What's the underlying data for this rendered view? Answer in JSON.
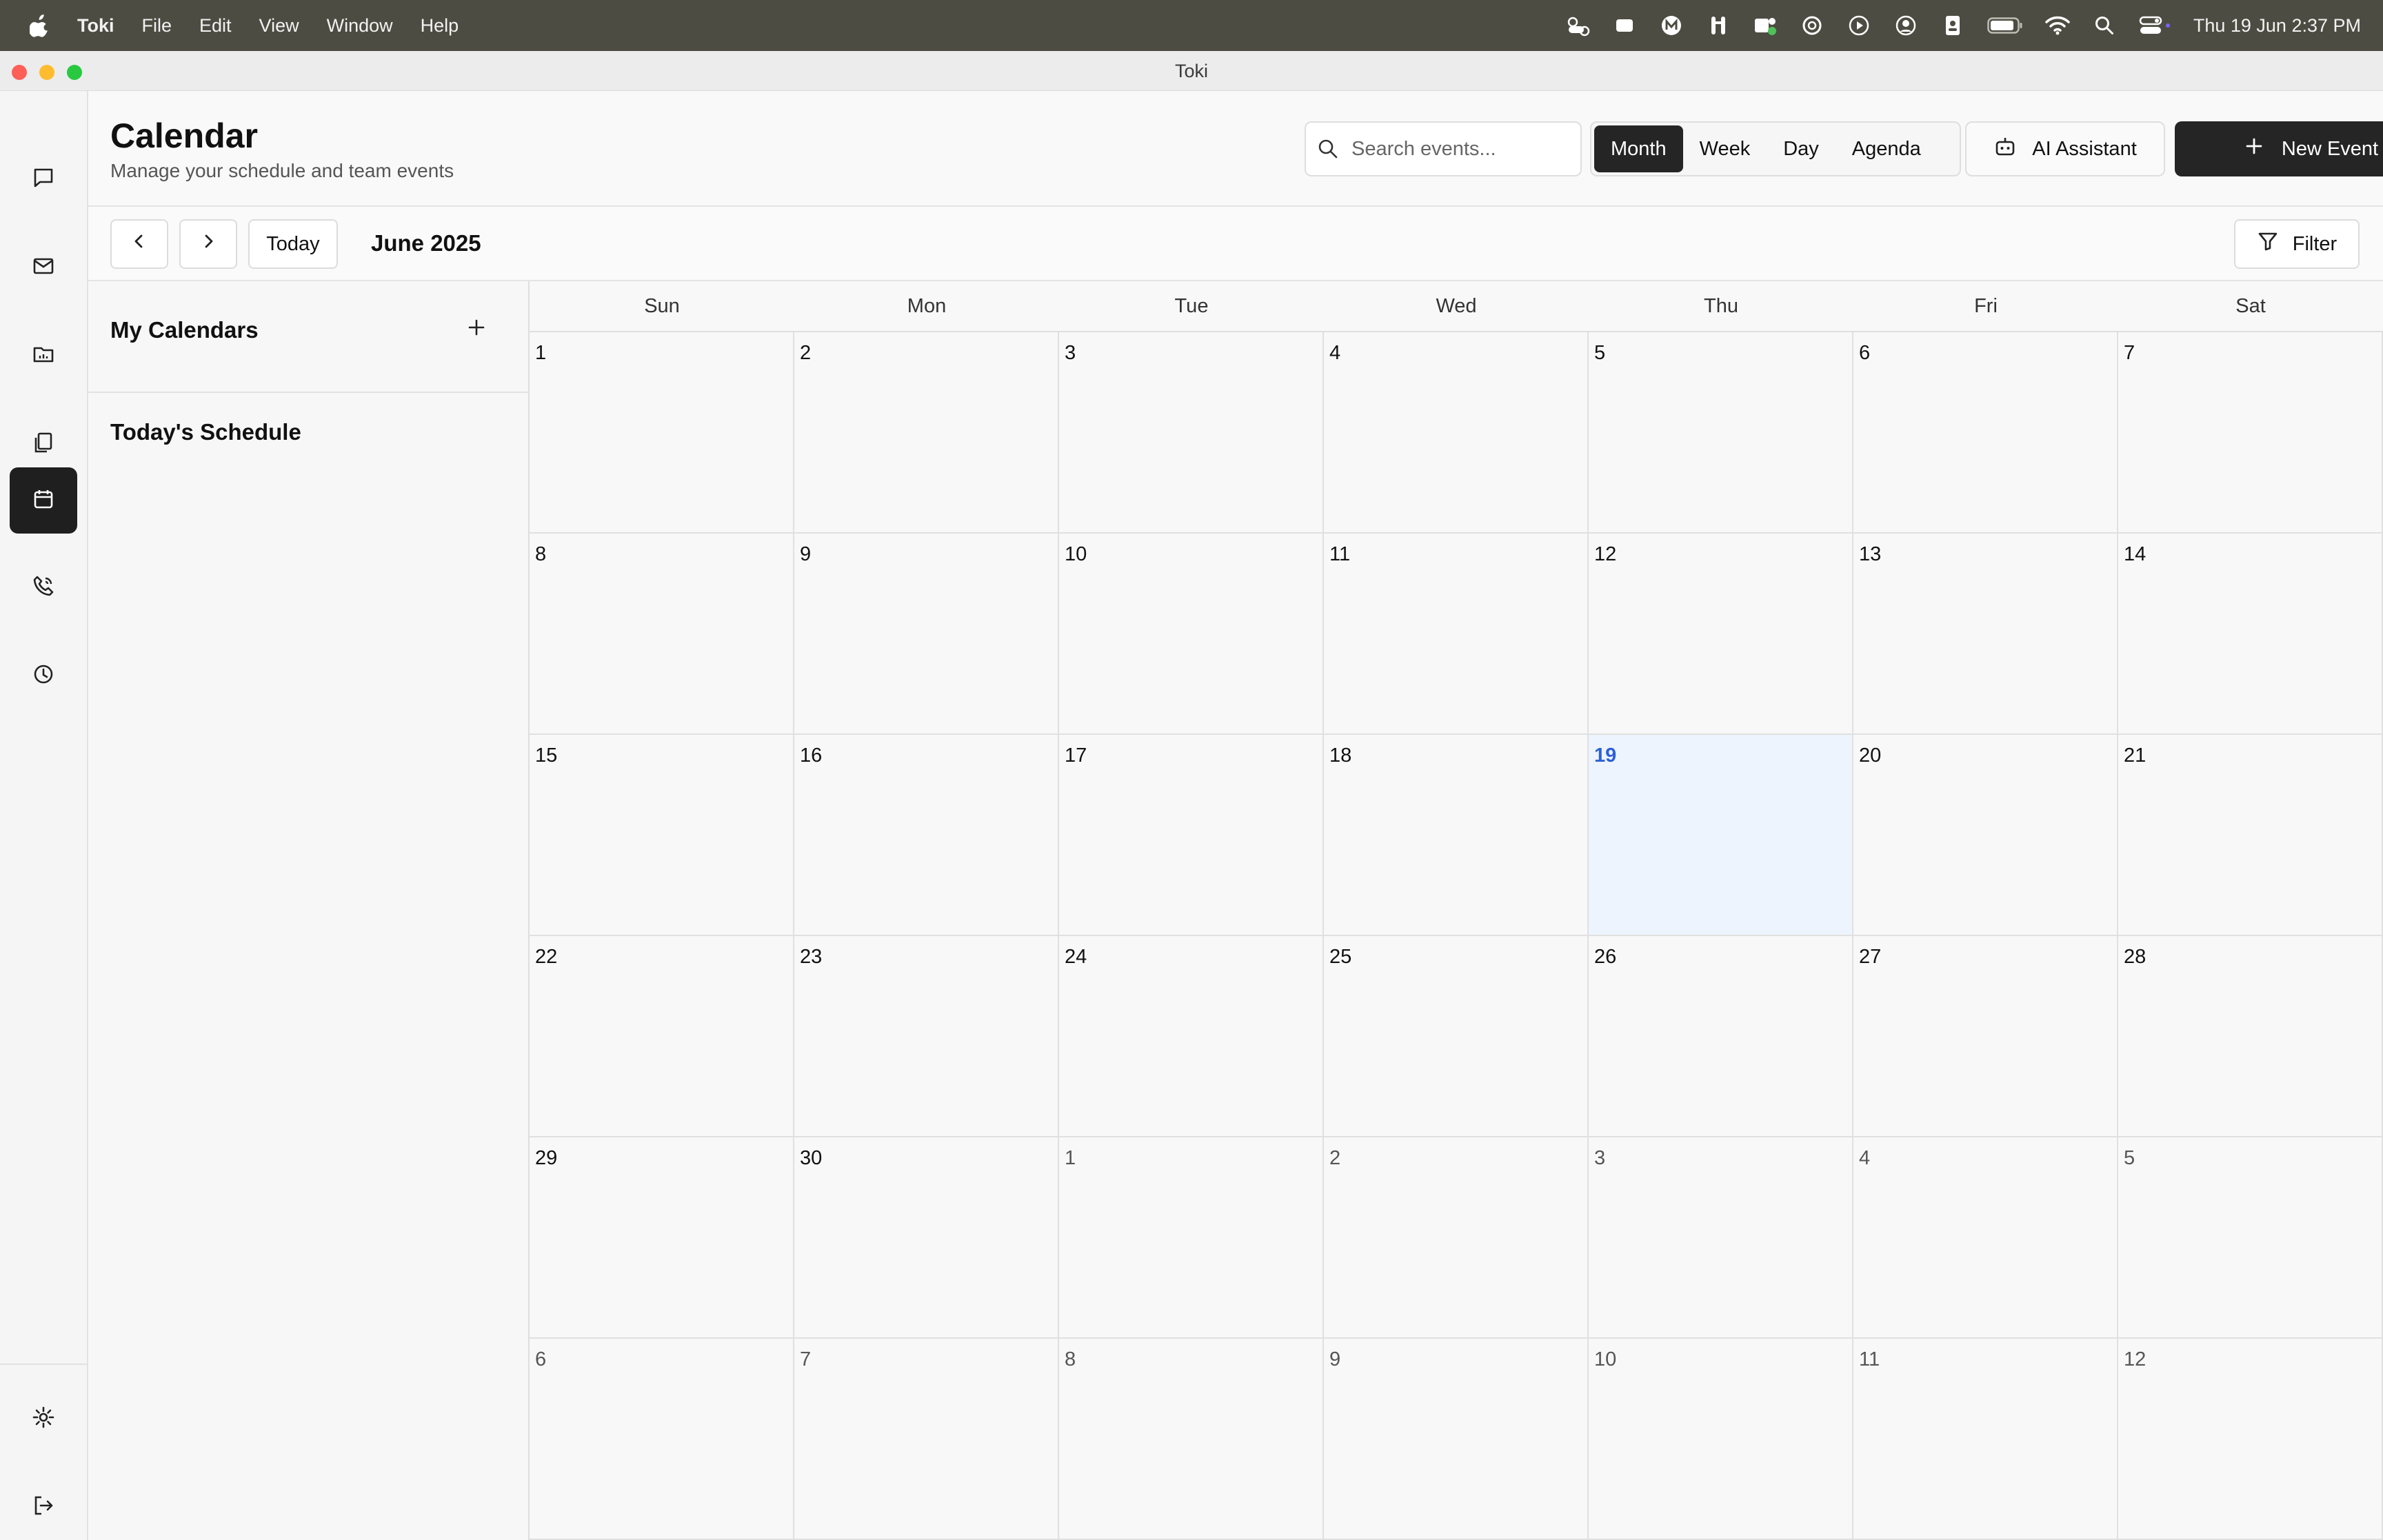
{
  "menubar": {
    "app_name": "Toki",
    "items": [
      "File",
      "Edit",
      "View",
      "Window",
      "Help"
    ],
    "clock": "Thu 19 Jun  2:37 PM"
  },
  "window": {
    "title": "Toki"
  },
  "header": {
    "title": "Calendar",
    "subtitle": "Manage your schedule and team events",
    "search_placeholder": "Search events...",
    "views": [
      "Month",
      "Week",
      "Day",
      "Agenda"
    ],
    "active_view": "Month",
    "ai_label": "AI Assistant",
    "new_event_label": "New Event"
  },
  "toolbar": {
    "today_label": "Today",
    "month_label": "June 2025",
    "filter_label": "Filter"
  },
  "sidebar": {
    "my_calendars": "My Calendars",
    "todays_schedule": "Today's Schedule"
  },
  "calendar": {
    "weekdays": [
      "Sun",
      "Mon",
      "Tue",
      "Wed",
      "Thu",
      "Fri",
      "Sat"
    ],
    "weeks": [
      [
        "1",
        "2",
        "3",
        "4",
        "5",
        "6",
        "7"
      ],
      [
        "8",
        "9",
        "10",
        "11",
        "12",
        "13",
        "14"
      ],
      [
        "15",
        "16",
        "17",
        "18",
        "19",
        "20",
        "21"
      ],
      [
        "22",
        "23",
        "24",
        "25",
        "26",
        "27",
        "28"
      ],
      [
        "29",
        "30",
        "1",
        "2",
        "3",
        "4",
        "5"
      ],
      [
        "6",
        "7",
        "8",
        "9",
        "10",
        "11",
        "12"
      ]
    ],
    "today": "19",
    "accent_color": "#2d5fd6"
  }
}
